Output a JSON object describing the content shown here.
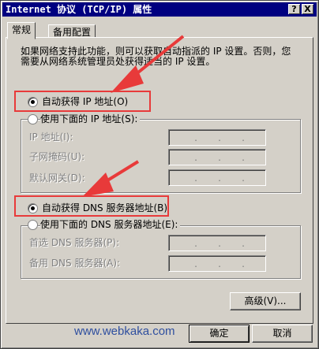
{
  "window": {
    "title": "Internet 协议 (TCP/IP) 属性",
    "help_label": "?",
    "close_label": "X"
  },
  "tabs": [
    {
      "label": "常规",
      "active": true
    },
    {
      "label": "备用配置",
      "active": false
    }
  ],
  "description": "如果网络支持此功能，则可以获取自动指派的 IP 设置。否则，您需要从网络系统管理员处获得适当的 IP 设置。",
  "ip_section": {
    "auto_label": "自动获得 IP 地址(O)",
    "auto_selected": true,
    "manual_label": "使用下面的 IP 地址(S):",
    "fields": [
      {
        "label": "IP 地址(I):",
        "value": ". . ."
      },
      {
        "label": "子网掩码(U):",
        "value": ". . ."
      },
      {
        "label": "默认网关(D):",
        "value": ". . ."
      }
    ]
  },
  "dns_section": {
    "auto_label": "自动获得 DNS 服务器地址(B)",
    "auto_selected": true,
    "manual_label": "使用下面的 DNS 服务器地址(E):",
    "fields": [
      {
        "label": "首选 DNS 服务器(P):",
        "value": ". . ."
      },
      {
        "label": "备用 DNS 服务器(A):",
        "value": ". . ."
      }
    ]
  },
  "buttons": {
    "advanced": "高级(V)...",
    "ok": "确定",
    "cancel": "取消"
  },
  "watermark": "www.webkaka.com",
  "colors": {
    "titlebar": "#000080",
    "highlight_box": "#e83a3a",
    "arrow": "#e83a3a",
    "face": "#d4d0c8"
  }
}
